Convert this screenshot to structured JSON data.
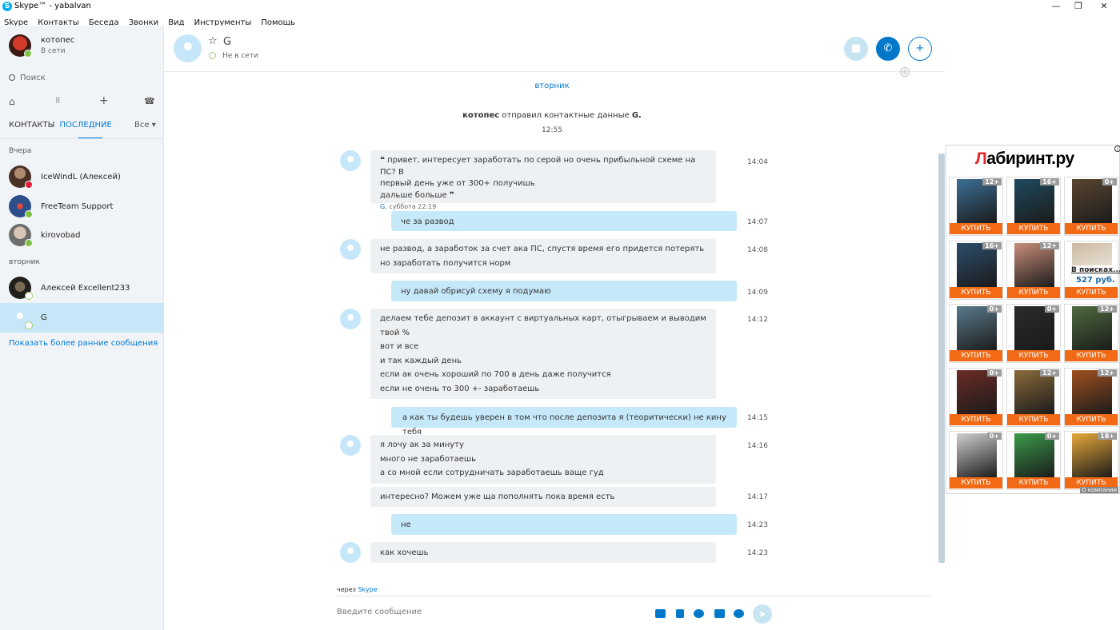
{
  "window": {
    "title": "Skype™ - yabalvan",
    "controls": [
      "—",
      "❐",
      "✕"
    ]
  },
  "menu": [
    "Skype",
    "Контакты",
    "Беседа",
    "Звонки",
    "Вид",
    "Инструменты",
    "Помощь"
  ],
  "profile": {
    "name": "котопес",
    "status": "В сети"
  },
  "search": {
    "placeholder": "Поиск"
  },
  "tabs": {
    "contacts": "КОНТАКТЫ",
    "recent": "ПОСЛЕДНИЕ",
    "filter": "Все"
  },
  "groups": [
    {
      "label": "Вчера",
      "contacts": [
        {
          "name": "IceWindL (Алексей)",
          "status": "busy"
        },
        {
          "name": "FreeTeam Support",
          "status": "online"
        },
        {
          "name": "kirovobad",
          "status": "online"
        }
      ]
    },
    {
      "label": "вторник",
      "contacts": [
        {
          "name": "Алексей Excellent233",
          "status": "offline"
        },
        {
          "name": "G",
          "status": "offline"
        }
      ]
    }
  ],
  "show_more": "Показать более ранние сообщения",
  "chat_header": {
    "name": "G",
    "status": "Не в сети"
  },
  "conversation": {
    "day": "вторник",
    "system": {
      "actor": "котопес",
      "text": "отправил контактные данные",
      "target": "G.",
      "time": "12:55"
    },
    "messages": [
      {
        "dir": "in",
        "time": "14:04",
        "quote": true,
        "lines": [
          "привет, интересует заработать по серой но очень прибыльной схеме на ПС? В",
          "первый день уже от 300+ получишь",
          "дальше больше"
        ],
        "meta_author": "G",
        "meta_time": ", суббота 22:19"
      },
      {
        "dir": "out",
        "time": "14:07",
        "lines": [
          "че за развод"
        ]
      },
      {
        "dir": "in",
        "time": "14:08",
        "lines": [
          "не развод, а заработок за счет ака ПС, спустя время его придется потерять",
          "но заработать получится норм"
        ]
      },
      {
        "dir": "out",
        "time": "14:09",
        "lines": [
          "ну давай обрисуй схему я подумаю"
        ]
      },
      {
        "dir": "in",
        "time": "14:12",
        "lines": [
          "делаем тебе депозит в аккаунт с виртуальных карт, отыгрываем и выводим",
          "твой %",
          "вот и все",
          "и так каждый день",
          "если ак очень хороший по 700 в день даже получится",
          "если не очень то 300 +- заработаешь"
        ]
      },
      {
        "dir": "out",
        "time": "14:15",
        "lines": [
          "а как ты будешь уверен в том что после депозита я (теоритически) не кину тебя"
        ]
      },
      {
        "dir": "in",
        "time": "14:16",
        "lines": [
          "я лочу ак за минуту",
          "много не заработаешь",
          "а со мной если сотрудничать заработаешь ваще гуд"
        ]
      },
      {
        "dir": "in",
        "time": "14:17",
        "lines": [
          "интересно? Можем уже ща пополнять пока время есть"
        ]
      },
      {
        "dir": "out",
        "time": "14:23",
        "lines": [
          "не"
        ]
      },
      {
        "dir": "in",
        "time": "14:23",
        "lines": [
          "как хочешь"
        ]
      }
    ]
  },
  "composer": {
    "via_prefix": "через",
    "via_link": "Skype",
    "placeholder": "Введите сообщение"
  },
  "ad": {
    "brand_red": "Л",
    "brand_rest": "абиринт.ру",
    "info": "i",
    "buy_label": "КУПИТЬ",
    "about": "О компании",
    "books": [
      {
        "age": "12+",
        "color": "#3c6f95"
      },
      {
        "age": "16+",
        "color": "#1f4a5e"
      },
      {
        "age": "0+",
        "color": "#5a4630"
      },
      {
        "age": "16+",
        "color": "#2c4d6b"
      },
      {
        "age": "12+",
        "color": "#c98e7a"
      },
      {
        "age": "",
        "color": "#6b7c8a",
        "search_text": "В поисках...",
        "price": "527 руб."
      },
      {
        "age": "0+",
        "color": "#5a7a8c"
      },
      {
        "age": "0+",
        "color": "#2b2b2b"
      },
      {
        "age": "12+",
        "color": "#4d6b3f"
      },
      {
        "age": "0+",
        "color": "#6b2c25"
      },
      {
        "age": "12+",
        "color": "#8a6a3a"
      },
      {
        "age": "12+",
        "color": "#a0501f"
      },
      {
        "age": "0+",
        "color": "#cfcfcf"
      },
      {
        "age": "0+",
        "color": "#3b9a4a"
      },
      {
        "age": "18+",
        "color": "#e8a83a"
      }
    ]
  },
  "colors": {
    "accent": "#0078d7",
    "bubble_out": "#c6e9fa",
    "bubble_in": "#eef1f4",
    "buy": "#f26a16"
  }
}
